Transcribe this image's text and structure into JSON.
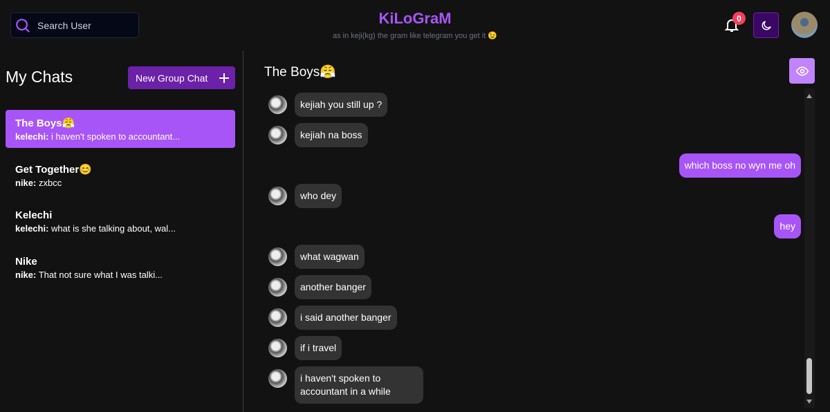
{
  "header": {
    "search_placeholder": "Search User",
    "title": "KiLoGraM",
    "subtitle": "as in keji(kg) the gram like telegram you get it 😉",
    "notification_count": "0",
    "accent": "#a855f7"
  },
  "sidebar": {
    "heading": "My Chats",
    "new_group_label": "New Group Chat",
    "chats": [
      {
        "name": "The Boys😤",
        "sender": "kelechi:",
        "preview": "i haven't spoken to accountant...",
        "active": true
      },
      {
        "name": "Get Together😊",
        "sender": "nike:",
        "preview": "zxbcc"
      },
      {
        "name": "Kelechi",
        "sender": "kelechi:",
        "preview": "what is she talking about, wal..."
      },
      {
        "name": "Nike",
        "sender": "nike:",
        "preview": "That not sure what I was talki..."
      }
    ]
  },
  "chat": {
    "title": "The Boys😤",
    "messages": [
      {
        "text": "kejiah you still up ?",
        "mine": false
      },
      {
        "text": "kejiah na boss",
        "mine": false
      },
      {
        "text": "which boss no wyn me oh",
        "mine": true
      },
      {
        "text": "who dey",
        "mine": false
      },
      {
        "text": "hey",
        "mine": true
      },
      {
        "text": "what wagwan",
        "mine": false
      },
      {
        "text": "another banger",
        "mine": false
      },
      {
        "text": "i said another banger",
        "mine": false
      },
      {
        "text": "if i travel",
        "mine": false
      },
      {
        "text": "i haven't spoken to accountant in a while",
        "mine": false
      }
    ]
  }
}
